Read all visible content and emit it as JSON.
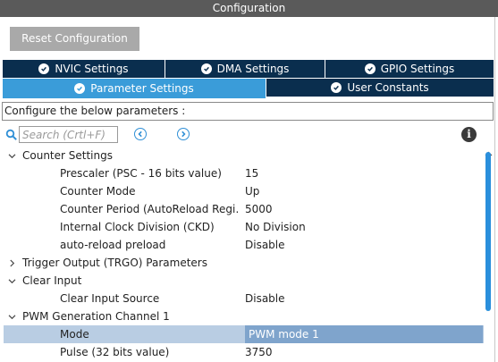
{
  "window": {
    "title": "Configuration"
  },
  "toolbar": {
    "reset_label": "Reset Configuration"
  },
  "tabs": {
    "row1": [
      {
        "label": "NVIC Settings",
        "active": false
      },
      {
        "label": "DMA Settings",
        "active": false
      },
      {
        "label": "GPIO Settings",
        "active": false
      }
    ],
    "row2": [
      {
        "label": "Parameter Settings",
        "active": true
      },
      {
        "label": "User Constants",
        "active": false
      }
    ]
  },
  "description": "Configure the below parameters :",
  "search": {
    "placeholder": "Search (Crtl+F)",
    "value": ""
  },
  "tree": {
    "counter_settings": {
      "label": "Counter Settings",
      "expanded": true,
      "items": [
        {
          "name": "Prescaler (PSC - 16 bits value)",
          "value": "15"
        },
        {
          "name": "Counter Mode",
          "value": "Up"
        },
        {
          "name": "Counter Period (AutoReload Regi…",
          "value": "5000"
        },
        {
          "name": "Internal Clock Division (CKD)",
          "value": "No Division"
        },
        {
          "name": "auto-reload preload",
          "value": "Disable"
        }
      ]
    },
    "trigger_output": {
      "label": "Trigger Output (TRGO) Parameters",
      "expanded": false
    },
    "clear_input": {
      "label": "Clear Input",
      "expanded": true,
      "items": [
        {
          "name": "Clear Input Source",
          "value": "Disable"
        }
      ]
    },
    "pwm_channel_1": {
      "label": "PWM Generation Channel 1",
      "expanded": true,
      "items": [
        {
          "name": "Mode",
          "value": "PWM mode 1",
          "selected": true
        },
        {
          "name": "Pulse (32 bits value)",
          "value": "3750"
        }
      ]
    }
  },
  "colors": {
    "titlebar": "#5a5a5a",
    "tab_inactive": "#0a2e4e",
    "tab_active": "#3a9cd9",
    "selection": "#b9cde3",
    "selection_value": "#7fa4cc",
    "scrollbar_thumb": "#2a8fdc"
  }
}
